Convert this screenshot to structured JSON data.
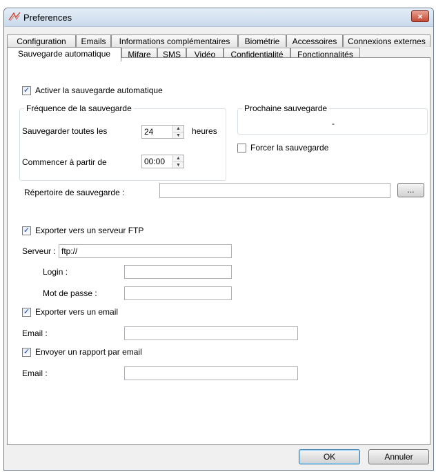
{
  "window": {
    "title": "Preferences",
    "close_glyph": "×"
  },
  "tabs": {
    "row1": [
      "Configuration",
      "Emails",
      "Informations complémentaires",
      "Biométrie",
      "Accessoires",
      "Connexions externes"
    ],
    "row2": [
      "Sauvegarde automatique",
      "Mifare",
      "SMS",
      "Vidéo",
      "Confidentialité",
      "Fonctionnalités"
    ],
    "active": "Sauvegarde automatique"
  },
  "autosave": {
    "enable_label": "Activer la sauvegarde automatique",
    "enable_checked": true,
    "frequency_group": "Fréquence de la sauvegarde",
    "save_every_label": "Sauvegarder toutes les",
    "save_every_value": "24",
    "save_every_unit": "heures",
    "start_label": "Commencer à partir de",
    "start_value": "00:00",
    "next_group": "Prochaine sauvegarde",
    "next_value": "-",
    "force_label": "Forcer la sauvegarde",
    "force_checked": false,
    "directory_label": "Répertoire de sauvegarde :",
    "directory_value": "",
    "browse_label": "..."
  },
  "ftp": {
    "export_label": "Exporter vers un serveur FTP",
    "export_checked": true,
    "server_label": "Serveur :",
    "server_value": "ftp://",
    "login_label": "Login :",
    "login_value": "",
    "password_label": "Mot de passe :",
    "password_value": ""
  },
  "email_export": {
    "export_label": "Exporter vers un email",
    "export_checked": true,
    "email_label": "Email :",
    "email_value": ""
  },
  "report": {
    "send_label": "Envoyer un rapport par email",
    "send_checked": true,
    "email_label": "Email :",
    "email_value": ""
  },
  "footer": {
    "ok_label": "OK",
    "cancel_label": "Annuler"
  },
  "icons": {
    "check": "✓",
    "spin_up": "▲",
    "spin_down": "▼"
  }
}
